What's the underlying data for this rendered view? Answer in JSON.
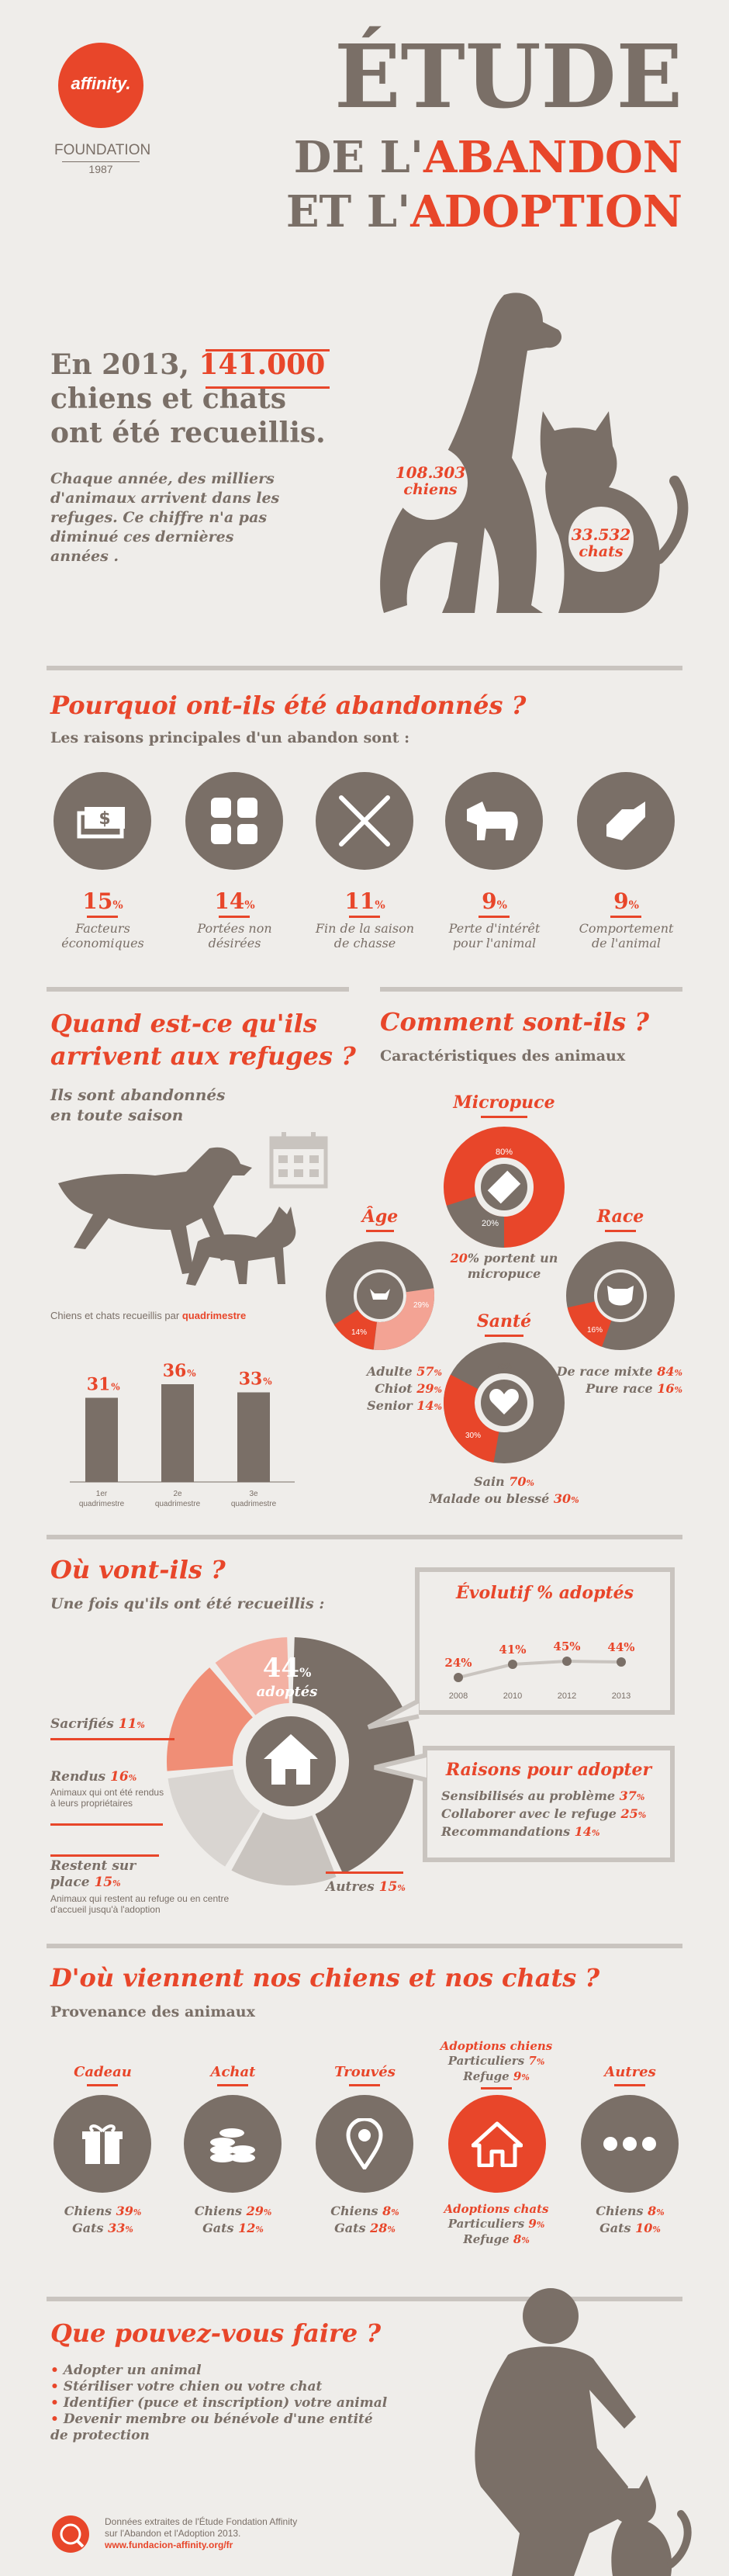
{
  "brand": {
    "name": "affinity.",
    "foundation": "FOUNDATION",
    "year": "1987"
  },
  "title": {
    "line1": "ÉTUDE",
    "line2_prefix": "DE L'",
    "line2_word": "ABANDON",
    "line3_prefix": "ET L'",
    "line3_word": "ADOPTION"
  },
  "intro": {
    "headline_prefix": "En 2013,",
    "headline_number": "141.000",
    "headline_rest1": "chiens et chats",
    "headline_rest2": "ont été recueillis.",
    "body": "Chaque année, des milliers d'animaux arrivent dans les refuges. Ce chiffre n'a pas diminué ces dernières années .",
    "dogs_count": "108.303",
    "dogs_label": "chiens",
    "cats_count": "33.532",
    "cats_label": "chats"
  },
  "reasons": {
    "title": "Pourquoi ont-ils été abandonnés ?",
    "subtitle": "Les raisons principales d'un abandon sont :",
    "items": [
      {
        "pct": "15",
        "unit": "%",
        "label": "Facteurs économiques",
        "icon": "money-icon"
      },
      {
        "pct": "14",
        "unit": "%",
        "label": "Portées non désirées",
        "icon": "litter-icon"
      },
      {
        "pct": "11",
        "unit": "%",
        "label": "Fin de la saison de chasse",
        "icon": "rifle-icon"
      },
      {
        "pct": "9",
        "unit": "%",
        "label": "Perte d'intérêt pour l'animal",
        "icon": "bored-dog-icon"
      },
      {
        "pct": "9",
        "unit": "%",
        "label": "Comportement de l'animal",
        "icon": "bite-icon"
      }
    ]
  },
  "when": {
    "title1": "Quand est-ce qu'ils",
    "title2": "arrivent aux refuges ?",
    "subtitle1": "Ils sont abandonnés",
    "subtitle2": "en toute saison",
    "chart_caption_prefix": "Chiens et chats recueillis par",
    "chart_caption_word": "quadrimestre"
  },
  "chart_data": {
    "type": "bar",
    "categories": [
      "1er quadrimestre",
      "2e quadrimestre",
      "3e quadrimestre"
    ],
    "values": [
      31,
      36,
      33
    ],
    "unit": "%"
  },
  "how": {
    "title": "Comment sont-ils ?",
    "subtitle": "Caractéristiques des animaux",
    "micropuce": {
      "title": "Micropuce",
      "pct_a": "80%",
      "pct_b": "20%",
      "text_pct": "20",
      "text": "% portent un micropuce"
    },
    "age": {
      "title": "Âge",
      "p1": "57%",
      "p2": "29%",
      "p3": "14%",
      "lines": [
        {
          "label": "Adulte",
          "v": "57"
        },
        {
          "label": "Chiot",
          "v": "29"
        },
        {
          "label": "Senior",
          "v": "14"
        }
      ]
    },
    "race": {
      "title": "Race",
      "p1": "84%",
      "p2": "16%",
      "lines": [
        {
          "label": "De race mixte",
          "v": "84"
        },
        {
          "label": "Pure race",
          "v": "16"
        }
      ]
    },
    "sante": {
      "title": "Santé",
      "p1": "70%",
      "p2": "30%",
      "lines": [
        {
          "label": "Sain",
          "v": "70"
        },
        {
          "label": "Malade ou blessé",
          "v": "30"
        }
      ]
    }
  },
  "where": {
    "title": "Où vont-ils ?",
    "subtitle": "Une fois qu'ils ont été recueillis :",
    "adopted_pct": "44",
    "adopted_label": "adoptés",
    "sacrifies": {
      "label": "Sacrifiés",
      "v": "11"
    },
    "rendus": {
      "label": "Rendus",
      "v": "16",
      "desc": "Animaux qui ont été rendus à leurs propriétaires"
    },
    "restent": {
      "label": "Restent sur place",
      "v": "15",
      "desc": "Animaux qui restent au refuge ou en centre d'accueil jusqu'à l'adoption"
    },
    "autres": {
      "label": "Autres",
      "v": "15"
    },
    "evolutif": {
      "title": "Évolutif % adoptés",
      "years": [
        "2008",
        "2010",
        "2012",
        "2013"
      ],
      "values": [
        "24%",
        "41%",
        "45%",
        "44%"
      ]
    },
    "raisons": {
      "title": "Raisons pour adopter",
      "lines": [
        {
          "label": "Sensibilisés au problème",
          "v": "37"
        },
        {
          "label": "Collaborer avec le refuge",
          "v": "25"
        },
        {
          "label": "Recommandations",
          "v": "14"
        }
      ]
    }
  },
  "origin": {
    "title": "D'où viennent nos chiens et nos chats ?",
    "subtitle": "Provenance des animaux",
    "items": [
      {
        "title": "Cadeau",
        "l1": "Chiens",
        "v1": "39",
        "l2": "Gats",
        "v2": "33",
        "icon": "gift-icon"
      },
      {
        "title": "Achat",
        "l1": "Chiens",
        "v1": "29",
        "l2": "Gats",
        "v2": "12",
        "icon": "coins-icon"
      },
      {
        "title": "Trouvés",
        "l1": "Chiens",
        "v1": "8",
        "l2": "Gats",
        "v2": "28",
        "icon": "location-pin-icon"
      },
      {
        "title": "Autres",
        "l1": "Chiens",
        "v1": "8",
        "l2": "Gats",
        "v2": "10",
        "icon": "dots-icon"
      }
    ],
    "adoptions_chiens": {
      "title": "Adoptions chiens",
      "l1": "Particuliers",
      "v1": "7",
      "l2": "Refuge",
      "v2": "9"
    },
    "adoptions_chats": {
      "title": "Adoptions chats",
      "l1": "Particuliers",
      "v1": "9",
      "l2": "Refuge",
      "v2": "8"
    }
  },
  "todo": {
    "title": "Que pouvez-vous faire ?",
    "items": [
      "Adopter un animal",
      "Stériliser votre chien ou votre chat",
      "Identifier (puce et inscription) votre animal",
      "Devenir membre ou bénévole d'une entité de protection"
    ]
  },
  "footer": {
    "line1": "Données extraites de l'Étude Fondation Affinity",
    "line2": "sur l'Abandon et l'Adoption 2013.",
    "url": "www.fundacion-affinity.org/fr"
  },
  "colors": {
    "brown": "#7a6f67",
    "red": "#e8462a",
    "light": "#c9c4bf",
    "bg": "#efedea"
  }
}
